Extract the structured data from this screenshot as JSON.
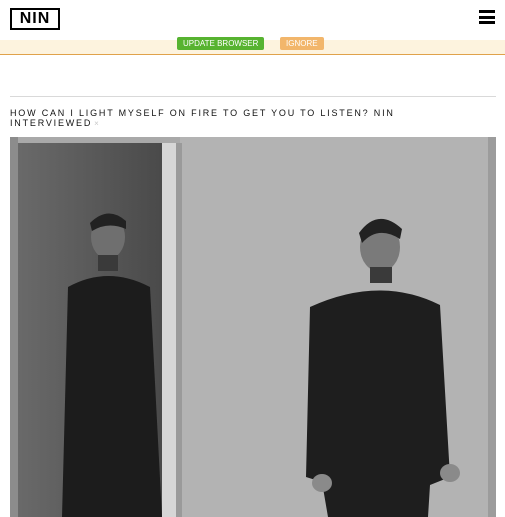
{
  "header": {
    "logo_text": "NIN",
    "menu_icon": "hamburger-icon"
  },
  "banner": {
    "update_label": "UPDATE BROWSER",
    "ignore_label": "IGNORE",
    "colors": {
      "update": "#57b330",
      "ignore": "#f2b66b",
      "background": "#fdf3de"
    }
  },
  "article": {
    "title": "HOW CAN I LIGHT MYSELF ON FIRE TO GET YOU TO LISTEN? NIN INTERVIEWED",
    "close_symbol": "×"
  }
}
